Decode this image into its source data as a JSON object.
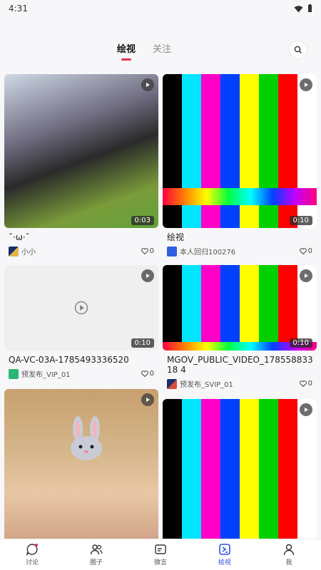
{
  "status_bar": {
    "time": "4:31"
  },
  "header": {
    "tabs": [
      {
        "label": "绘视",
        "active": true
      },
      {
        "label": "关注",
        "active": false
      }
    ],
    "search_icon": "search-icon"
  },
  "colors": {
    "accent": "#e4334e",
    "nav_active": "#2d4fe0"
  },
  "feed": {
    "cards": [
      {
        "title": "˘·ω·˘",
        "author": "小小",
        "likes": "0",
        "duration": "0:03",
        "thumb": "crowd-photo"
      },
      {
        "title": "绘视",
        "author": "本人回归100276",
        "likes": "0",
        "duration": "0:10",
        "thumb": "color-bars"
      },
      {
        "title": "QA-VC-03A-1785493336520",
        "author": "预发布_VIP_01",
        "likes": "0",
        "duration": "0:10",
        "thumb": "placeholder"
      },
      {
        "title": "MGOV_PUBLIC_VIDEO_17855883318 4",
        "author": "预发布_SVIP_01",
        "likes": "0",
        "duration": "0:10",
        "thumb": "color-bars"
      },
      {
        "title": "",
        "author": "",
        "likes": "",
        "duration": "",
        "thumb": "girl-photo"
      },
      {
        "title": "",
        "author": "",
        "likes": "",
        "duration": "",
        "thumb": "color-bars"
      }
    ]
  },
  "bottom_nav": {
    "items": [
      {
        "label": "讨论",
        "icon": "chat-bubble-icon",
        "active": false
      },
      {
        "label": "圈子",
        "icon": "people-icon",
        "active": false
      },
      {
        "label": "微言",
        "icon": "message-card-icon",
        "active": false
      },
      {
        "label": "绘视",
        "icon": "video-icon",
        "active": true
      },
      {
        "label": "我",
        "icon": "person-icon",
        "active": false
      }
    ]
  }
}
